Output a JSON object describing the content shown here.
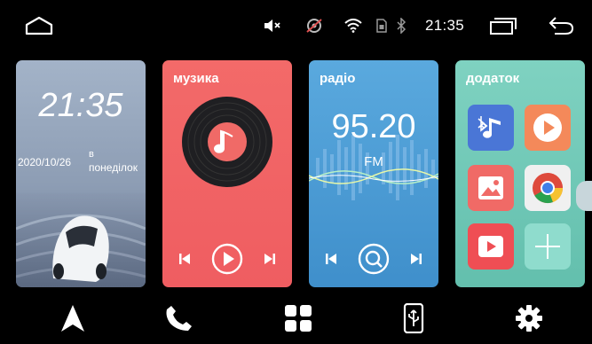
{
  "status_bar": {
    "time": "21:35",
    "icons": [
      "home-icon",
      "mute-icon",
      "gps-off-icon",
      "wifi-icon",
      "sim-icon",
      "bluetooth-icon",
      "recents-icon",
      "back-icon"
    ]
  },
  "clock_widget": {
    "time": "21:35",
    "date": "2020/10/26",
    "weekday_prep": "в",
    "weekday": "понеділок"
  },
  "music_widget": {
    "title": "музика"
  },
  "radio_widget": {
    "title": "радіо",
    "frequency": "95.20",
    "band": "FM"
  },
  "apps_widget": {
    "title": "додаток",
    "apps": [
      "bluetooth-music-icon",
      "video-player-icon",
      "gallery-icon",
      "chrome-icon",
      "youtube-icon",
      "add-icon"
    ]
  },
  "dock": {
    "items": [
      "navigation-icon",
      "phone-icon",
      "apps-grid-icon",
      "phone-link-icon",
      "settings-icon"
    ]
  },
  "colors": {
    "clock_card": "#95a5bb",
    "music_card": "#f0625f",
    "radio_card": "#4a9ad6",
    "apps_card": "#72c9b6"
  }
}
